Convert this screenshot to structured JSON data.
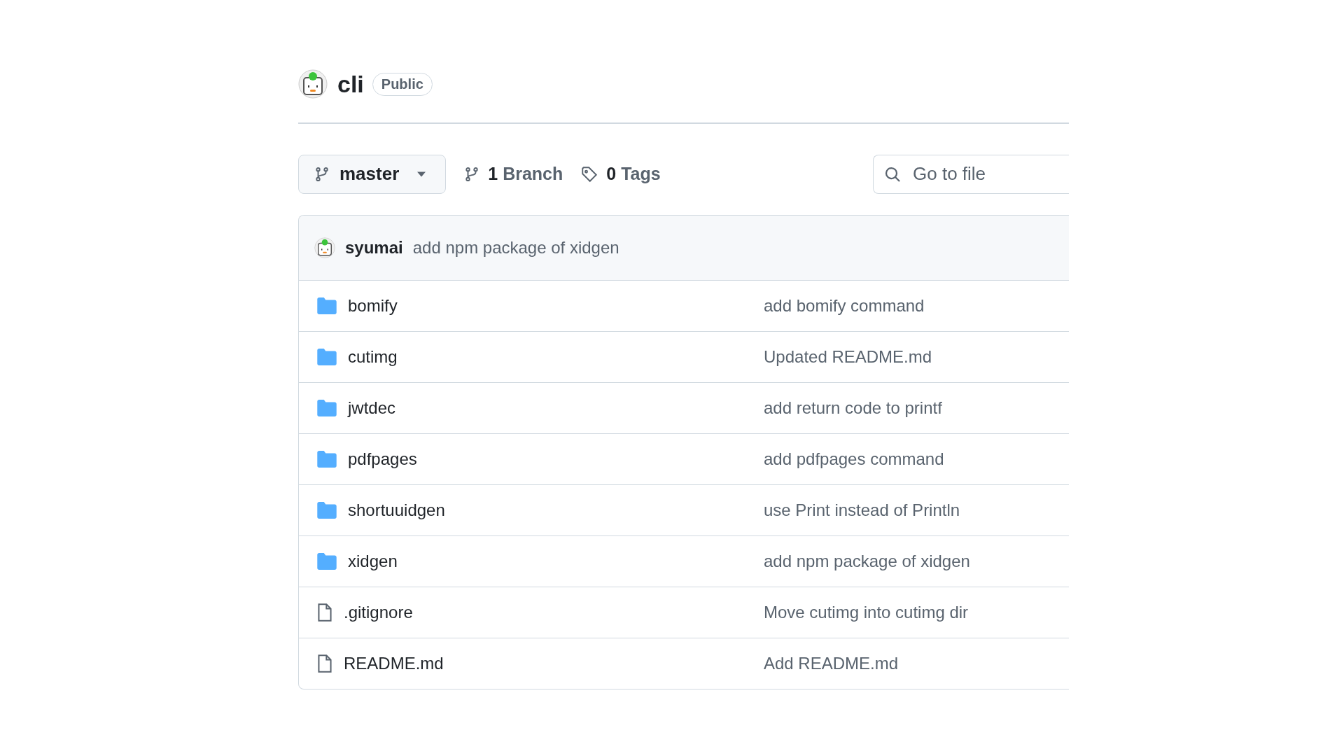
{
  "repo": {
    "name": "cli",
    "visibility": "Public"
  },
  "toolbar": {
    "branch": "master",
    "branch_count": "1",
    "branch_label": "Branch",
    "tag_count": "0",
    "tag_label": "Tags",
    "search": {
      "placeholder": "Go to file"
    }
  },
  "latest_commit": {
    "author": "syumai",
    "message": "add npm package of xidgen"
  },
  "files": [
    {
      "kind": "folder",
      "name": "bomify",
      "message": "add bomify command"
    },
    {
      "kind": "folder",
      "name": "cutimg",
      "message": "Updated README.md"
    },
    {
      "kind": "folder",
      "name": "jwtdec",
      "message": "add return code to printf"
    },
    {
      "kind": "folder",
      "name": "pdfpages",
      "message": "add pdfpages command"
    },
    {
      "kind": "folder",
      "name": "shortuuidgen",
      "message": "use Print instead of Println"
    },
    {
      "kind": "folder",
      "name": "xidgen",
      "message": "add npm package of xidgen"
    },
    {
      "kind": "file",
      "name": ".gitignore",
      "message": "Move cutimg into cutimg dir"
    },
    {
      "kind": "file",
      "name": "README.md",
      "message": "Add README.md"
    }
  ]
}
